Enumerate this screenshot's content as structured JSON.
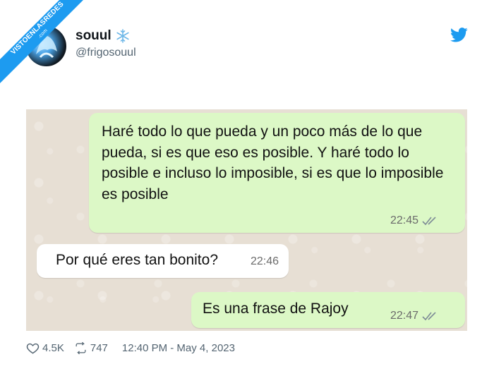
{
  "ribbon": {
    "text": "VISTOENLASREDES",
    "sub": ".com"
  },
  "user": {
    "display_name": "souul",
    "handle": "@frigosouul"
  },
  "chat": {
    "messages": [
      {
        "direction": "out",
        "text": "Haré todo lo que pueda y un poco más de lo que pueda, si es que eso es posible. Y haré todo lo posible e incluso lo imposible, si es que lo imposible es posible",
        "time": "22:45",
        "ticks": "read"
      },
      {
        "direction": "in",
        "text": "Por qué eres tan bonito?",
        "time": "22:46"
      },
      {
        "direction": "out",
        "text": "Es una frase de Rajoy",
        "time": "22:47",
        "ticks": "read"
      }
    ]
  },
  "footer": {
    "likes": "4.5K",
    "retweets": "747",
    "timestamp": "12:40 PM - May 4, 2023"
  },
  "icons": {
    "brand": "twitter-bird-icon",
    "emoji": "snowflake-icon",
    "like": "heart-icon",
    "retweet": "retweet-icon",
    "read": "double-check-icon"
  },
  "colors": {
    "accent": "#1d9bf0",
    "outgoing_bubble": "#dcf8c6",
    "incoming_bubble": "#ffffff",
    "chat_bg": "#e7dfd4"
  }
}
